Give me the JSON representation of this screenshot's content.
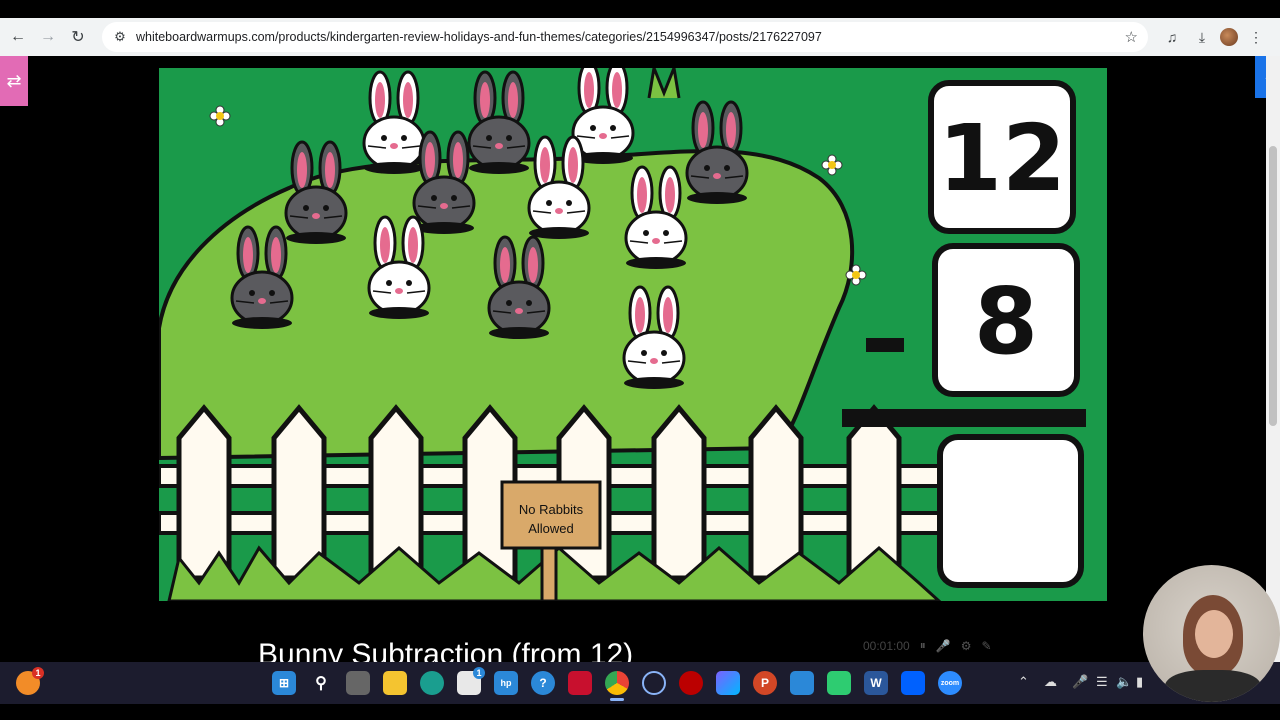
{
  "browser": {
    "url": "whiteboardwarmups.com/products/kindergarten-review-holidays-and-fun-themes/categories/2154996347/posts/2176227097"
  },
  "slide": {
    "top_number": "12",
    "minus_sign": "-",
    "second_number": "8",
    "answer": "",
    "sign_text_line1": "No Rabbits",
    "sign_text_line2": "Allowed",
    "colors": {
      "background": "#1a9a4a",
      "grass": "#7cc242",
      "fence": "#fffaf0",
      "sign": "#d9a96a"
    }
  },
  "caption": "Bunny Subtraction (from 12)",
  "player": {
    "time": "00:01:00"
  },
  "taskbar": {
    "notification_count": "1",
    "store_badge": "1"
  }
}
